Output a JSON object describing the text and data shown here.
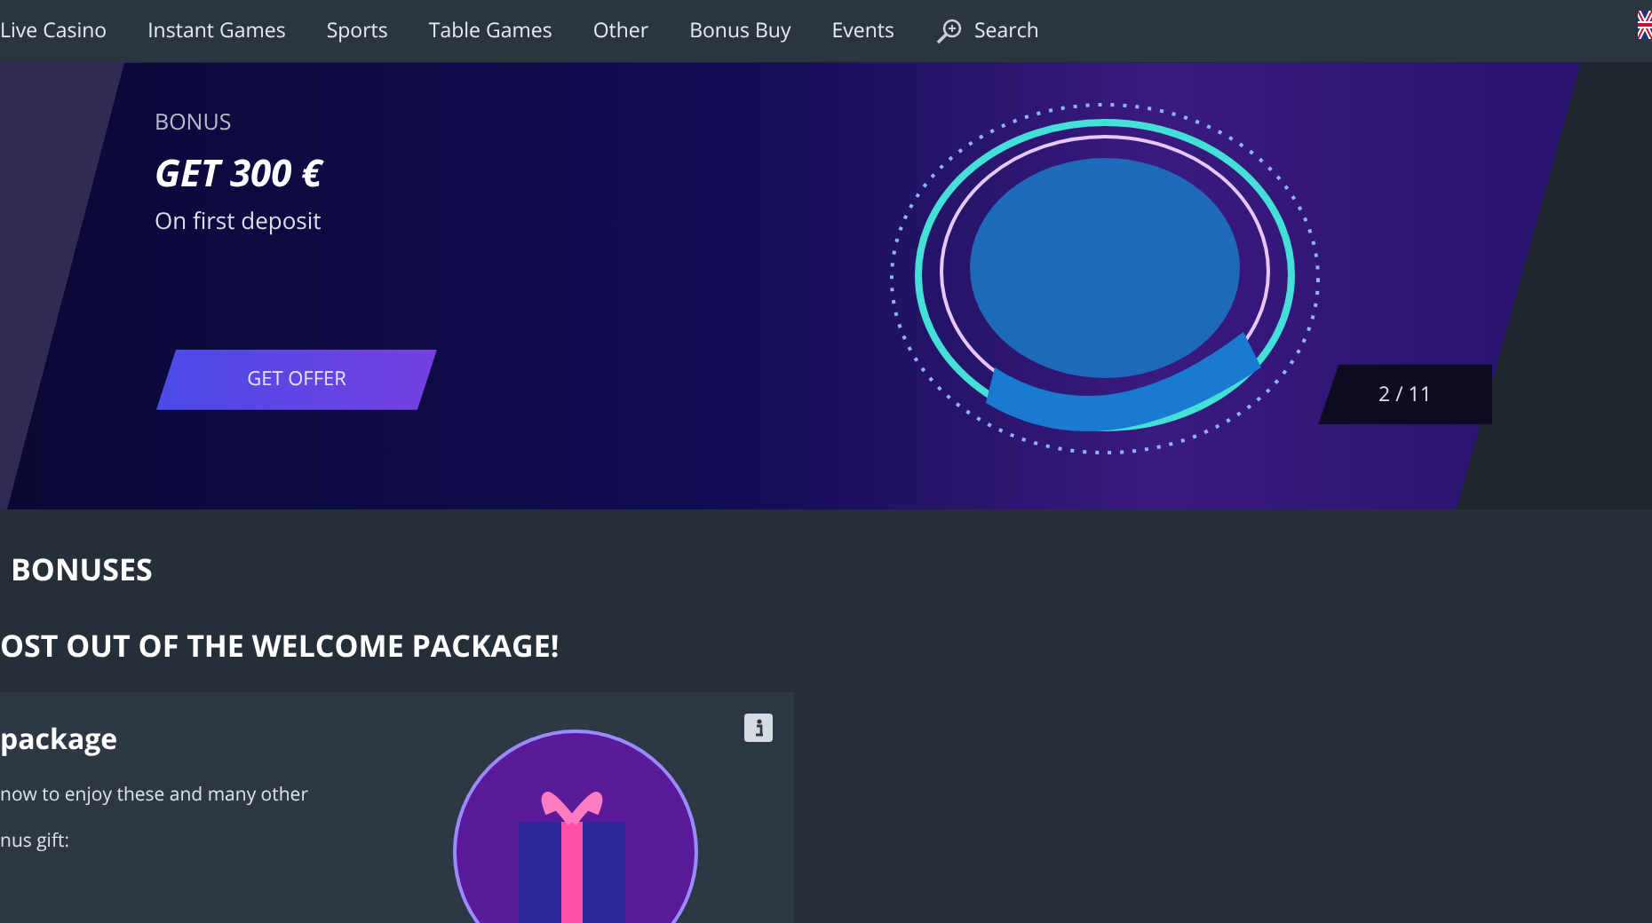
{
  "nav": {
    "items": [
      {
        "label": "Live Casino"
      },
      {
        "label": "Instant Games"
      },
      {
        "label": "Sports"
      },
      {
        "label": "Table Games"
      },
      {
        "label": "Other"
      },
      {
        "label": "Bonus Buy"
      },
      {
        "label": "Events"
      }
    ],
    "search": "Search"
  },
  "banner": {
    "eyebrow": "BONUS",
    "title": "GET 300 €",
    "subtitle": "On first deposit",
    "button": "GET OFFER",
    "counter": "2 / 11"
  },
  "section": {
    "title": "BONUSES",
    "subtitle": "OST OUT OF THE WELCOME PACKAGE!"
  },
  "card": {
    "title": "package",
    "lines": [
      "now to enjoy these and many other",
      "nus gift:"
    ]
  }
}
